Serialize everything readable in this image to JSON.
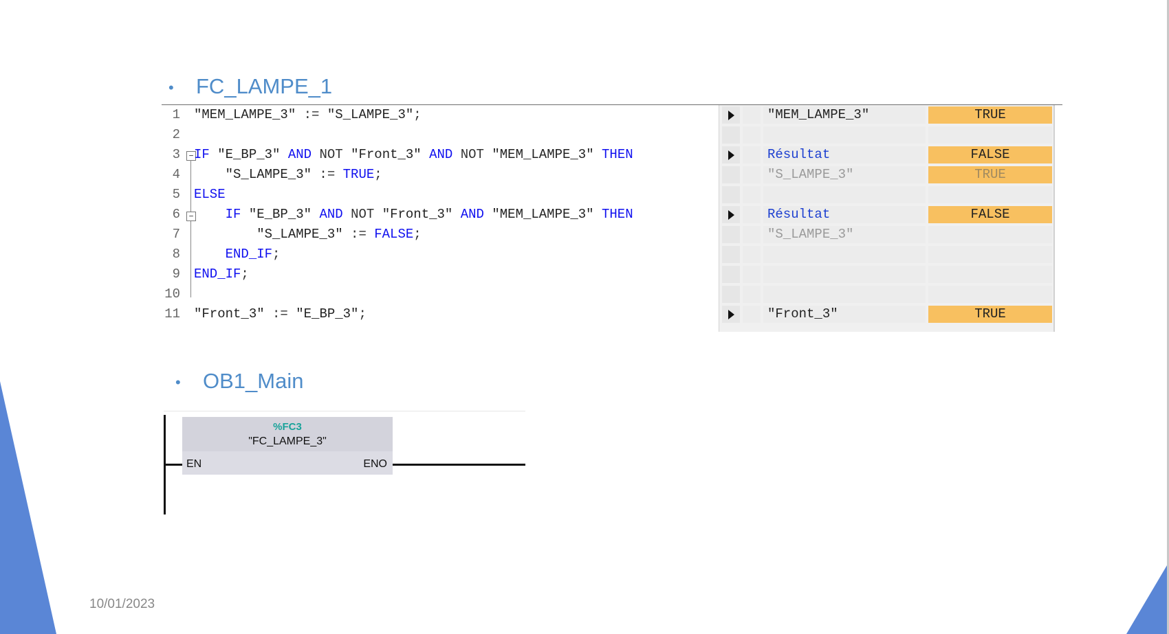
{
  "slide": {
    "section1_bullet": "•",
    "section1_title": "FC_LAMPE_1",
    "section2_bullet": "•",
    "section2_title": "OB1_Main",
    "date": "10/01/2023"
  },
  "code": {
    "lines": [
      {
        "n": "1",
        "text": "\"MEM_LAMPE_3\" := \"S_LAMPE_3\";"
      },
      {
        "n": "2",
        "text": ""
      },
      {
        "n": "3",
        "text": "IF \"E_BP_3\" AND NOT \"Front_3\" AND NOT \"MEM_LAMPE_3\" THEN"
      },
      {
        "n": "4",
        "text": "    \"S_LAMPE_3\" := TRUE;"
      },
      {
        "n": "5",
        "text": "ELSE"
      },
      {
        "n": "6",
        "text": "    IF \"E_BP_3\" AND NOT \"Front_3\" AND \"MEM_LAMPE_3\" THEN"
      },
      {
        "n": "7",
        "text": "        \"S_LAMPE_3\" := FALSE;"
      },
      {
        "n": "8",
        "text": "    END_IF;"
      },
      {
        "n": "9",
        "text": "END_IF;"
      },
      {
        "n": "10",
        "text": ""
      },
      {
        "n": "11",
        "text": "\"Front_3\" := \"E_BP_3\";"
      }
    ]
  },
  "watch": {
    "rows": [
      {
        "arrow": true,
        "name": "\"MEM_LAMPE_3\"",
        "value": "TRUE",
        "style": "normal",
        "highlight": true
      },
      {
        "arrow": false,
        "name": "",
        "value": "",
        "style": "normal",
        "highlight": false
      },
      {
        "arrow": true,
        "name": "Résultat",
        "value": "FALSE",
        "style": "result",
        "highlight": true
      },
      {
        "arrow": false,
        "name": "\"S_LAMPE_3\"",
        "value": "TRUE",
        "style": "dim",
        "highlight": true
      },
      {
        "arrow": false,
        "name": "",
        "value": "",
        "style": "normal",
        "highlight": false
      },
      {
        "arrow": true,
        "name": "Résultat",
        "value": "FALSE",
        "style": "result",
        "highlight": true
      },
      {
        "arrow": false,
        "name": "\"S_LAMPE_3\"",
        "value": "",
        "style": "dim",
        "highlight": false
      },
      {
        "arrow": false,
        "name": "",
        "value": "",
        "style": "normal",
        "highlight": false
      },
      {
        "arrow": false,
        "name": "",
        "value": "",
        "style": "normal",
        "highlight": false
      },
      {
        "arrow": false,
        "name": "",
        "value": "",
        "style": "normal",
        "highlight": false
      },
      {
        "arrow": true,
        "name": "\"Front_3\"",
        "value": "TRUE",
        "style": "normal",
        "highlight": true
      }
    ]
  },
  "ladder": {
    "block_address": "%FC3",
    "block_name": "\"FC_LAMPE_3\"",
    "pin_in": "EN",
    "pin_out": "ENO"
  },
  "colors": {
    "accent_blue": "#4f8cc9",
    "keyword_blue": "#1010ef",
    "highlight_orange": "#f8c060",
    "corner_blue": "#5a86d6"
  }
}
